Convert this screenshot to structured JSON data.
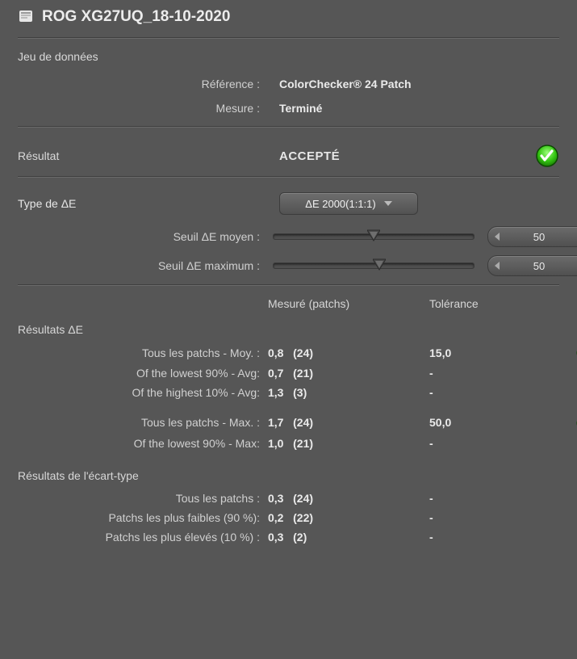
{
  "title": "ROG XG27UQ_18-10-2020",
  "dataset": {
    "heading": "Jeu de données",
    "reference_label": "Référence :",
    "reference_value": "ColorChecker® 24 Patch",
    "measure_label": "Mesure :",
    "measure_value": "Terminé"
  },
  "result": {
    "label": "Résultat",
    "value": "ACCEPTÉ"
  },
  "deltaE": {
    "type_label": "Type de ΔE",
    "type_value": "ΔE 2000(1:1:1)",
    "avg_threshold_label": "Seuil ΔE moyen :",
    "avg_threshold_value": "50",
    "avg_threshold_pos_pct": 50,
    "max_threshold_label": "Seuil ΔE maximum :",
    "max_threshold_value": "50",
    "max_threshold_pos_pct": 53
  },
  "results_table": {
    "measured_header": "Mesuré (patchs)",
    "tolerance_header": "Tolérance",
    "deltaE_heading": "Résultats ΔE",
    "stddev_heading": "Résultats de l'écart-type",
    "rows_deltaE": [
      {
        "label": "Tous les patchs - Moy. :",
        "measured": "0,8   (24)",
        "tolerance": "15,0",
        "status": "check"
      },
      {
        "label": "Of the lowest 90% - Avg:",
        "measured": "0,7   (21)",
        "tolerance": "-",
        "status": "-"
      },
      {
        "label": "Of the highest 10% - Avg:",
        "measured": "1,3   (3)",
        "tolerance": "-",
        "status": "-"
      }
    ],
    "rows_deltaE_max": [
      {
        "label": "Tous les patchs - Max. :",
        "measured": "1,7   (24)",
        "tolerance": "50,0",
        "status": "check"
      },
      {
        "label": "Of the lowest 90% - Max:",
        "measured": "1,0   (21)",
        "tolerance": "-",
        "status": "-"
      }
    ],
    "rows_stddev": [
      {
        "label": "Tous les patchs :",
        "measured": "0,3   (24)",
        "tolerance": "-",
        "status": "-"
      },
      {
        "label": "Patchs les plus faibles (90 %):",
        "measured": "0,2   (22)",
        "tolerance": "-",
        "status": "-"
      },
      {
        "label": "Patchs les plus élevés (10 %) :",
        "measured": "0,3   (2)",
        "tolerance": "-",
        "status": "-"
      }
    ]
  }
}
